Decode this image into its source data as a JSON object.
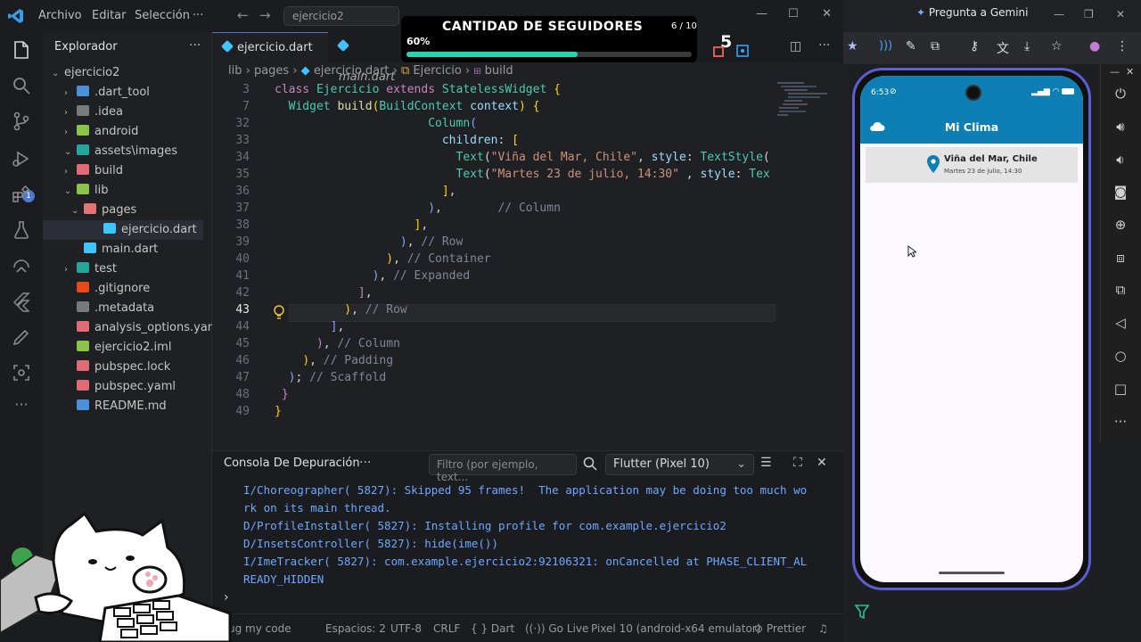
{
  "vscode": {
    "title_menu": [
      "Archivo",
      "Editar",
      "Selección"
    ],
    "search_placeholder": "ejercicio2",
    "explorer": {
      "title": "Explorador",
      "project": "ejercicio2",
      "items": [
        {
          "label": ".dart_tool",
          "color": "#4a8fd8",
          "chev": "›"
        },
        {
          "label": ".idea",
          "color": "#7a7a7a",
          "chev": "›"
        },
        {
          "label": "android",
          "color": "#8bc34a",
          "chev": "›"
        },
        {
          "label": "assets\\images",
          "color": "#26a69a",
          "chev": "⌄"
        },
        {
          "label": "build",
          "color": "#e06c75",
          "chev": "›"
        },
        {
          "label": "lib",
          "color": "#8bc34a",
          "chev": "⌄"
        },
        {
          "label": "pages",
          "color": "#e57373",
          "chev": "⌄"
        },
        {
          "label": "ejercicio.dart",
          "color": "#40c4ff",
          "chev": ""
        },
        {
          "label": "main.dart",
          "color": "#40c4ff",
          "chev": ""
        },
        {
          "label": "test",
          "color": "#26a69a",
          "chev": "›"
        },
        {
          "label": ".gitignore",
          "color": "#e64a19",
          "chev": ""
        },
        {
          "label": ".metadata",
          "color": "#7a7a7a",
          "chev": ""
        },
        {
          "label": "analysis_options.yaml",
          "color": "#e06c75",
          "chev": ""
        },
        {
          "label": "ejercicio2.iml",
          "color": "#8bc34a",
          "chev": ""
        },
        {
          "label": "pubspec.lock",
          "color": "#e06c75",
          "chev": ""
        },
        {
          "label": "pubspec.yaml",
          "color": "#e06c75",
          "chev": ""
        },
        {
          "label": "README.md",
          "color": "#4a8fd8",
          "chev": ""
        }
      ]
    },
    "tabs": [
      "ejercicio.dart",
      "main.dart"
    ],
    "breadcrumb": {
      "a": "lib",
      "b": "pages",
      "c": "ejercicio.dart",
      "d": "Ejercicio",
      "e": "build"
    },
    "code_lines": [
      {
        "n": "3",
        "html": "<span class='kw'>class</span> <span class='ty'>Ejercicio</span> <span class='kw'>extends</span> <span class='ty'>StatelessWidget</span> <span class='pn'>{</span>"
      },
      {
        "n": "7",
        "html": "  <span class='ty'>Widget</span> <span class='fn'>build</span><span class='pn'>(</span><span class='ty'>BuildContext</span> <span class='vr'>context</span><span class='pn'>)</span> <span class='pn'>{</span>"
      },
      {
        "n": "32",
        "html": "                      <span class='ty'>Column</span><span class='pl'>(</span>"
      },
      {
        "n": "33",
        "html": "                        <span class='vr'>children</span>: <span class='pn'>[</span>"
      },
      {
        "n": "34",
        "html": "                          <span class='ty'>Text</span>(<span class='st'>\"Viña del Mar, Chile\"</span>, <span class='vr'>style</span>: <span class='ty'>TextStyle</span>("
      },
      {
        "n": "35",
        "html": "                          <span class='ty'>Text</span>(<span class='st'>\"Martes 23 de julio, 14:30\"</span> , <span class='vr'>style</span>: <span class='ty'>Tex</span>"
      },
      {
        "n": "36",
        "html": "                        <span class='pn'>]</span>,"
      },
      {
        "n": "37",
        "html": "                      <span class='pl'>)</span>,        <span class='cm'>// Column</span>"
      },
      {
        "n": "38",
        "html": "                    <span class='pn'>]</span>,"
      },
      {
        "n": "39",
        "html": "                  <span class='pl'>)</span>, <span class='cm'>// Row</span>"
      },
      {
        "n": "40",
        "html": "                <span class='pn'>)</span>, <span class='cm'>// Container</span>"
      },
      {
        "n": "41",
        "html": "              <span class='pl'>)</span>, <span class='cm'>// Expanded</span>"
      },
      {
        "n": "42",
        "html": "            <span class='kw'>]</span>,"
      },
      {
        "n": "43",
        "html": "          <span class='pn'>)</span>, <span class='cm'>// Row</span>",
        "cur": true
      },
      {
        "n": "44",
        "html": "        <span class='pl'>]</span>,"
      },
      {
        "n": "45",
        "html": "      <span class='kw'>)</span>, <span class='cm'>// Column</span>"
      },
      {
        "n": "46",
        "html": "    <span class='pn'>)</span>, <span class='cm'>// Padding</span>"
      },
      {
        "n": "47",
        "html": "  <span class='pl'>)</span>; <span class='cm'>// Scaffold</span>"
      },
      {
        "n": "48",
        "html": " <span class='kw'>}</span>"
      },
      {
        "n": "49",
        "html": "<span class='pn'>}</span>"
      }
    ],
    "panel": {
      "title": "Consola De Depuración",
      "filter_placeholder": "Filtro (por ejemplo, text...",
      "device": "Flutter (Pixel 10)",
      "logs": [
        "I/Choreographer( 5827): Skipped 95 frames!  The application may be doing too much wo",
        "rk on its main thread.",
        "D/ProfileInstaller( 5827): Installing profile for com.example.ejercicio2",
        "D/InsetsController( 5827): hide(ime())",
        "I/ImeTracker( 5827): com.example.ejercicio2:92106321: onCancelled at PHASE_CLIENT_AL",
        "READY_HIDDEN"
      ]
    },
    "status": {
      "debug": "ug my code",
      "spaces": "Espacios: 2",
      "encoding": "UTF-8",
      "eol": "CRLF",
      "lang": "Dart",
      "golive": "Go Live",
      "device": "Pixel 10 (android-x64 emulator)",
      "prettier": "Prettier"
    }
  },
  "overlay": {
    "title": "CANTIDAD DE SEGUIDORES",
    "count": "6 / 10",
    "percent_label": "60%",
    "progress": 0.6,
    "number": "5"
  },
  "browser": {
    "gemini": "Pregunta a Gemini"
  },
  "phone": {
    "time": "6:53",
    "app_title": "Mi Clima",
    "city": "Viña del Mar, Chile",
    "date": "Martes 23 de julio, 14:30"
  },
  "colors": {
    "app_bar": "#0d7fb5",
    "accent": "#4d78cc",
    "progress": "#27d3b0"
  }
}
